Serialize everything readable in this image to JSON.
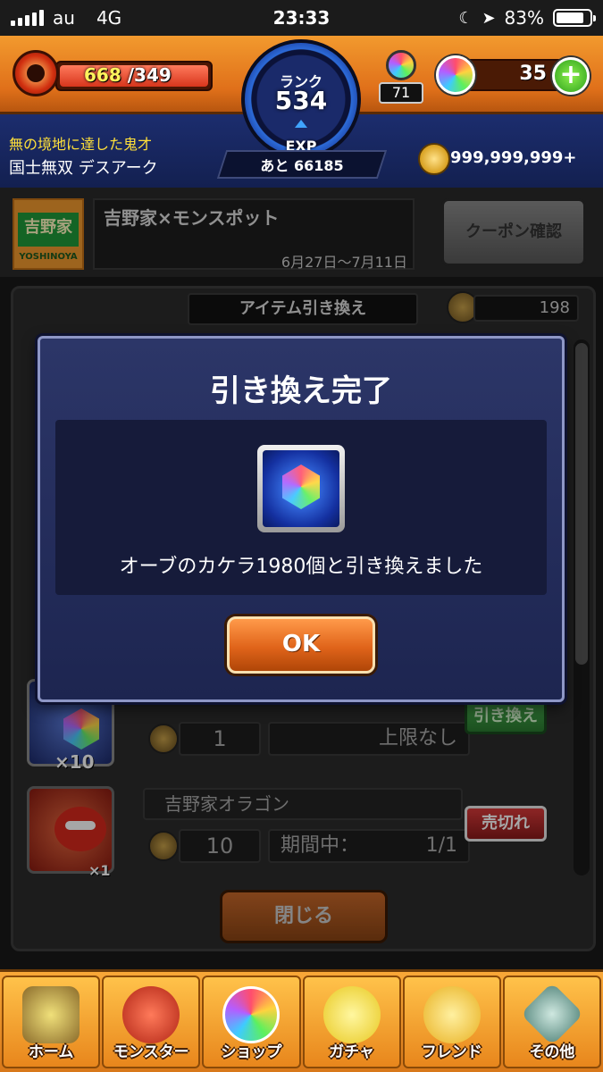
{
  "status_bar": {
    "carrier": "au",
    "network": "4G",
    "time": "23:33",
    "battery": "83%"
  },
  "header": {
    "stamina_current": "668",
    "stamina_max": "/349",
    "rank_label": "ランク",
    "rank_value": "534",
    "exp_label": "EXP",
    "exp_remaining": "あと 66185",
    "title_line1": "無の境地に達した鬼才",
    "title_line2": "国士無双 デスアーク",
    "keys_count": "71",
    "orbs_count": "35",
    "gold": "999,999,999+"
  },
  "banner": {
    "logo_jp": "吉野家",
    "logo_en": "YOSHINOYA",
    "title": "吉野家×モンスポット",
    "period": "6月27日〜7月11日",
    "coupon_button": "クーポン確認"
  },
  "exchange": {
    "header": "アイテム引き換え",
    "medal_count": "198",
    "items": [
      {
        "qty": "×10",
        "cost": "1",
        "limit": "上限なし",
        "action": "引き換え"
      },
      {
        "name": "吉野家オラゴン",
        "qty": "×1",
        "cost": "10",
        "limit_label": "期間中：",
        "limit_value": "1/1",
        "action": "売切れ"
      }
    ],
    "close_button": "閉じる"
  },
  "modal": {
    "title": "引き換え完了",
    "message": "オーブのカケラ1980個と引き換えました",
    "ok_button": "OK"
  },
  "nav": [
    {
      "label": "ホーム",
      "icon": "home-icon"
    },
    {
      "label": "モンスター",
      "icon": "monster-icon"
    },
    {
      "label": "ショップ",
      "icon": "orb-icon"
    },
    {
      "label": "ガチャ",
      "icon": "egg-icon"
    },
    {
      "label": "フレンド",
      "icon": "balloons-icon"
    },
    {
      "label": "その他",
      "icon": "other-icon"
    }
  ],
  "colors": {
    "header_orange": "#e0701a",
    "header_navy": "#1c2d6e",
    "modal_bg": "#2c3668",
    "ok_orange": "#e0641a",
    "exchange_green": "#2a7a30",
    "soldout_red": "#d83a3a"
  }
}
